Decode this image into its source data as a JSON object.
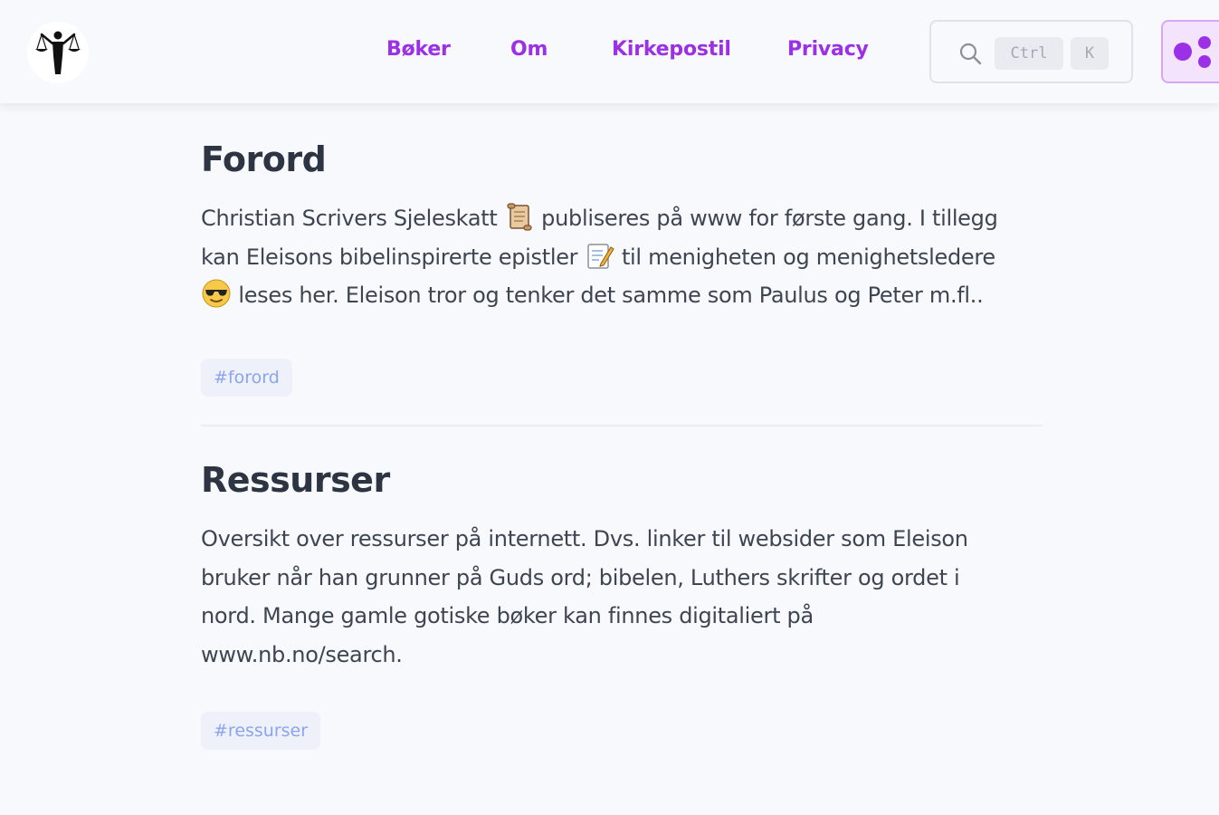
{
  "nav": {
    "links": [
      "Bøker",
      "Om",
      "Kirkepostil",
      "Privacy"
    ]
  },
  "search": {
    "kbd_ctrl": "Ctrl",
    "kbd_k": "K"
  },
  "posts": [
    {
      "title": "Forord",
      "text_parts": [
        "Christian Scrivers Sjeleskatt",
        "publiseres på www for første gang. I tillegg kan Eleisons bibelinspirerte epistler",
        "til menigheten og menighetsledere",
        "leses her. Eleison tror og tenker det samme som Paulus og Peter m.fl.."
      ],
      "emojis": [
        "scroll-emoji",
        "memo-emoji",
        "sunglasses-emoji"
      ],
      "tag": "#forord"
    },
    {
      "title": "Ressurser",
      "text": "Oversikt over ressurser på internett. Dvs. linker til websider som Eleison bruker når han grunner på Guds ord; bibelen, Luthers skrifter og ordet i nord. Mange gamle gotiske bøker kan finnes digitaliert på www.nb.no/search.",
      "tag": "#ressurser"
    }
  ],
  "colors": {
    "accent": "#9b30e6",
    "title": "#2d3442",
    "text": "#3e4552",
    "tag_bg": "#eef1fa",
    "tag_text": "#8ba4ee",
    "background": "#f8f9fc"
  }
}
